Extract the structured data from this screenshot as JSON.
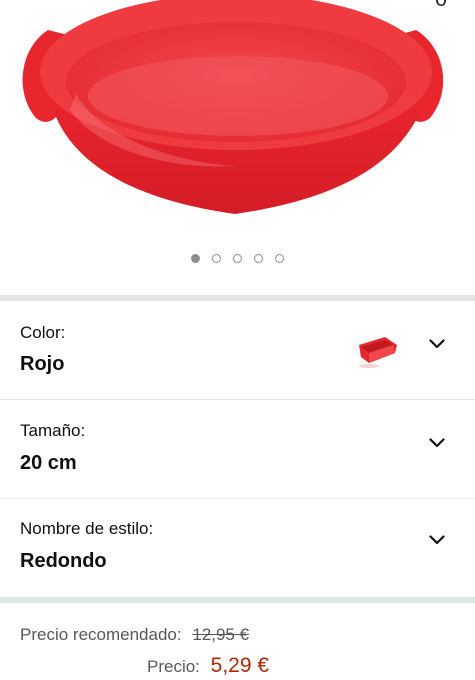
{
  "gallery": {
    "badge": "6",
    "dots_total": 5,
    "active_dot": 1,
    "product_color": "#e8262e"
  },
  "variations": [
    {
      "label": "Color:",
      "value": "Rojo"
    },
    {
      "label": "Tamaño:",
      "value": "20 cm"
    },
    {
      "label": "Nombre de estilo:",
      "value": "Redondo"
    }
  ],
  "pricing": {
    "recommended_label": "Precio recomendado:",
    "recommended_value": "12,95 €",
    "price_label": "Precio:",
    "price_value": "5,29 €",
    "price_color": "#b12704"
  },
  "icons": {
    "dropdown": "chevron-down-icon",
    "thumbnail": "red-mold-thumbnail"
  }
}
